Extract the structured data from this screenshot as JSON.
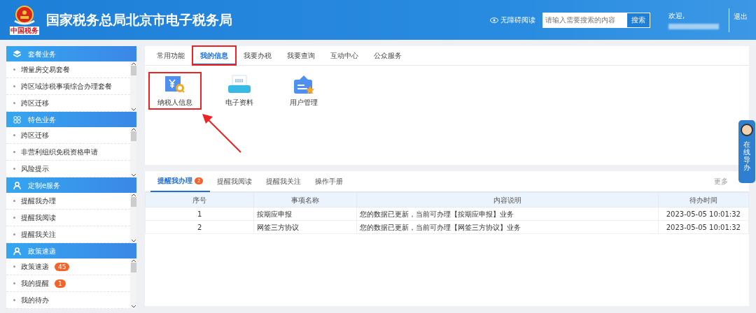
{
  "header": {
    "logo_text": "中国税务",
    "title": "国家税务总局北京市电子税务局",
    "accessibility": "无障碍阅读",
    "search": {
      "placeholder": "请输入需要搜索的内容",
      "button": "搜索"
    },
    "welcome": "欢迎,",
    "logout": "退出"
  },
  "sidebar": [
    {
      "title": "套餐业务",
      "kind": "stack",
      "items": [
        {
          "label": "增量房交易套餐"
        },
        {
          "label": "跨区域涉税事项综合办理套餐"
        },
        {
          "label": "跨区迁移"
        }
      ]
    },
    {
      "title": "特色业务",
      "kind": "grid",
      "items": [
        {
          "label": "跨区迁移"
        },
        {
          "label": "非营利组织免税资格申请"
        },
        {
          "label": "风险提示"
        }
      ]
    },
    {
      "title": "定制e服务",
      "kind": "person",
      "items": [
        {
          "label": "提醒我办理"
        },
        {
          "label": "提醒我阅读"
        },
        {
          "label": "提醒我关注"
        }
      ]
    },
    {
      "title": "政策速递",
      "kind": "person",
      "items": [
        {
          "label": "政策速递",
          "badge": "45"
        },
        {
          "label": "我的提醒",
          "badge": "1"
        },
        {
          "label": "我的待办"
        }
      ]
    }
  ],
  "top_tabs": [
    {
      "label": "常用功能",
      "selected": false,
      "highlighted": false
    },
    {
      "label": "我的信息",
      "selected": true,
      "highlighted": true
    },
    {
      "label": "我要办税",
      "selected": false,
      "highlighted": false
    },
    {
      "label": "我要查询",
      "selected": false,
      "highlighted": false
    },
    {
      "label": "互动中心",
      "selected": false,
      "highlighted": false
    },
    {
      "label": "公众服务",
      "selected": false,
      "highlighted": false
    }
  ],
  "apps": [
    {
      "label": "纳税人信息",
      "kind": "taxpayer",
      "highlighted": true
    },
    {
      "label": "电子资料",
      "kind": "scanner",
      "highlighted": false
    },
    {
      "label": "用户管理",
      "kind": "badge",
      "highlighted": false
    }
  ],
  "reminders": {
    "tabs": [
      {
        "label": "提醒我办理",
        "selected": true,
        "badge": "2"
      },
      {
        "label": "提醒我阅读",
        "selected": false
      },
      {
        "label": "提醒我关注",
        "selected": false
      },
      {
        "label": "操作手册",
        "selected": false
      }
    ],
    "more": "更多",
    "columns": [
      "序号",
      "事项名称",
      "内容说明",
      "待办时间"
    ],
    "rows": [
      [
        "1",
        "按期应申报",
        "您的数据已更新，当前可办理【按期应申报】业务",
        "2023-05-05 10:01:32"
      ],
      [
        "2",
        "网签三方协议",
        "您的数据已更新，当前可办理【网签三方协议】业务",
        "2023-05-05 10:01:32"
      ]
    ]
  },
  "guide_widget": {
    "label": "在线导办"
  }
}
